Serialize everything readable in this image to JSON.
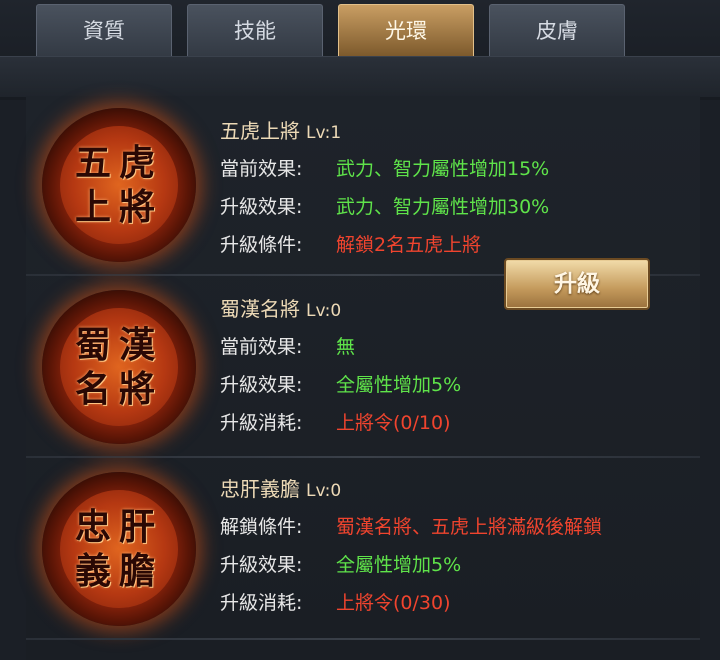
{
  "tabs": [
    {
      "label": "資質"
    },
    {
      "label": "技能"
    },
    {
      "label": "光環"
    },
    {
      "label": "皮膚"
    }
  ],
  "active_tab": "光環",
  "auras": [
    {
      "emblem": "五虎\n上將",
      "name": "五虎上將",
      "level": "Lv:1",
      "lines": [
        {
          "label": "當前效果:",
          "value": "武力、智力屬性增加15%",
          "color": "green"
        },
        {
          "label": "升級效果:",
          "value": "武力、智力屬性增加30%",
          "color": "green"
        },
        {
          "label": "升級條件:",
          "value": "解鎖2名五虎上將",
          "color": "red"
        }
      ]
    },
    {
      "emblem": "蜀漢\n名將",
      "name": "蜀漢名將",
      "level": "Lv:0",
      "lines": [
        {
          "label": "當前效果:",
          "value": "無",
          "color": "green"
        },
        {
          "label": "升級效果:",
          "value": "全屬性增加5%",
          "color": "green"
        },
        {
          "label": "升級消耗:",
          "value": "上將令(0/10)",
          "color": "red"
        }
      ]
    },
    {
      "emblem": "忠肝\n義膽",
      "name": "忠肝義膽",
      "level": "Lv:0",
      "lines": [
        {
          "label": "解鎖條件:",
          "value": "蜀漢名將、五虎上將滿級後解鎖",
          "color": "red"
        },
        {
          "label": "升級效果:",
          "value": "全屬性增加5%",
          "color": "green"
        },
        {
          "label": "升級消耗:",
          "value": "上將令(0/30)",
          "color": "red"
        }
      ]
    }
  ],
  "upgrade_button": {
    "label": "升級"
  },
  "colors": {
    "green": "#5fe34a",
    "red": "#f0442e",
    "gold": "#c49a5c"
  }
}
